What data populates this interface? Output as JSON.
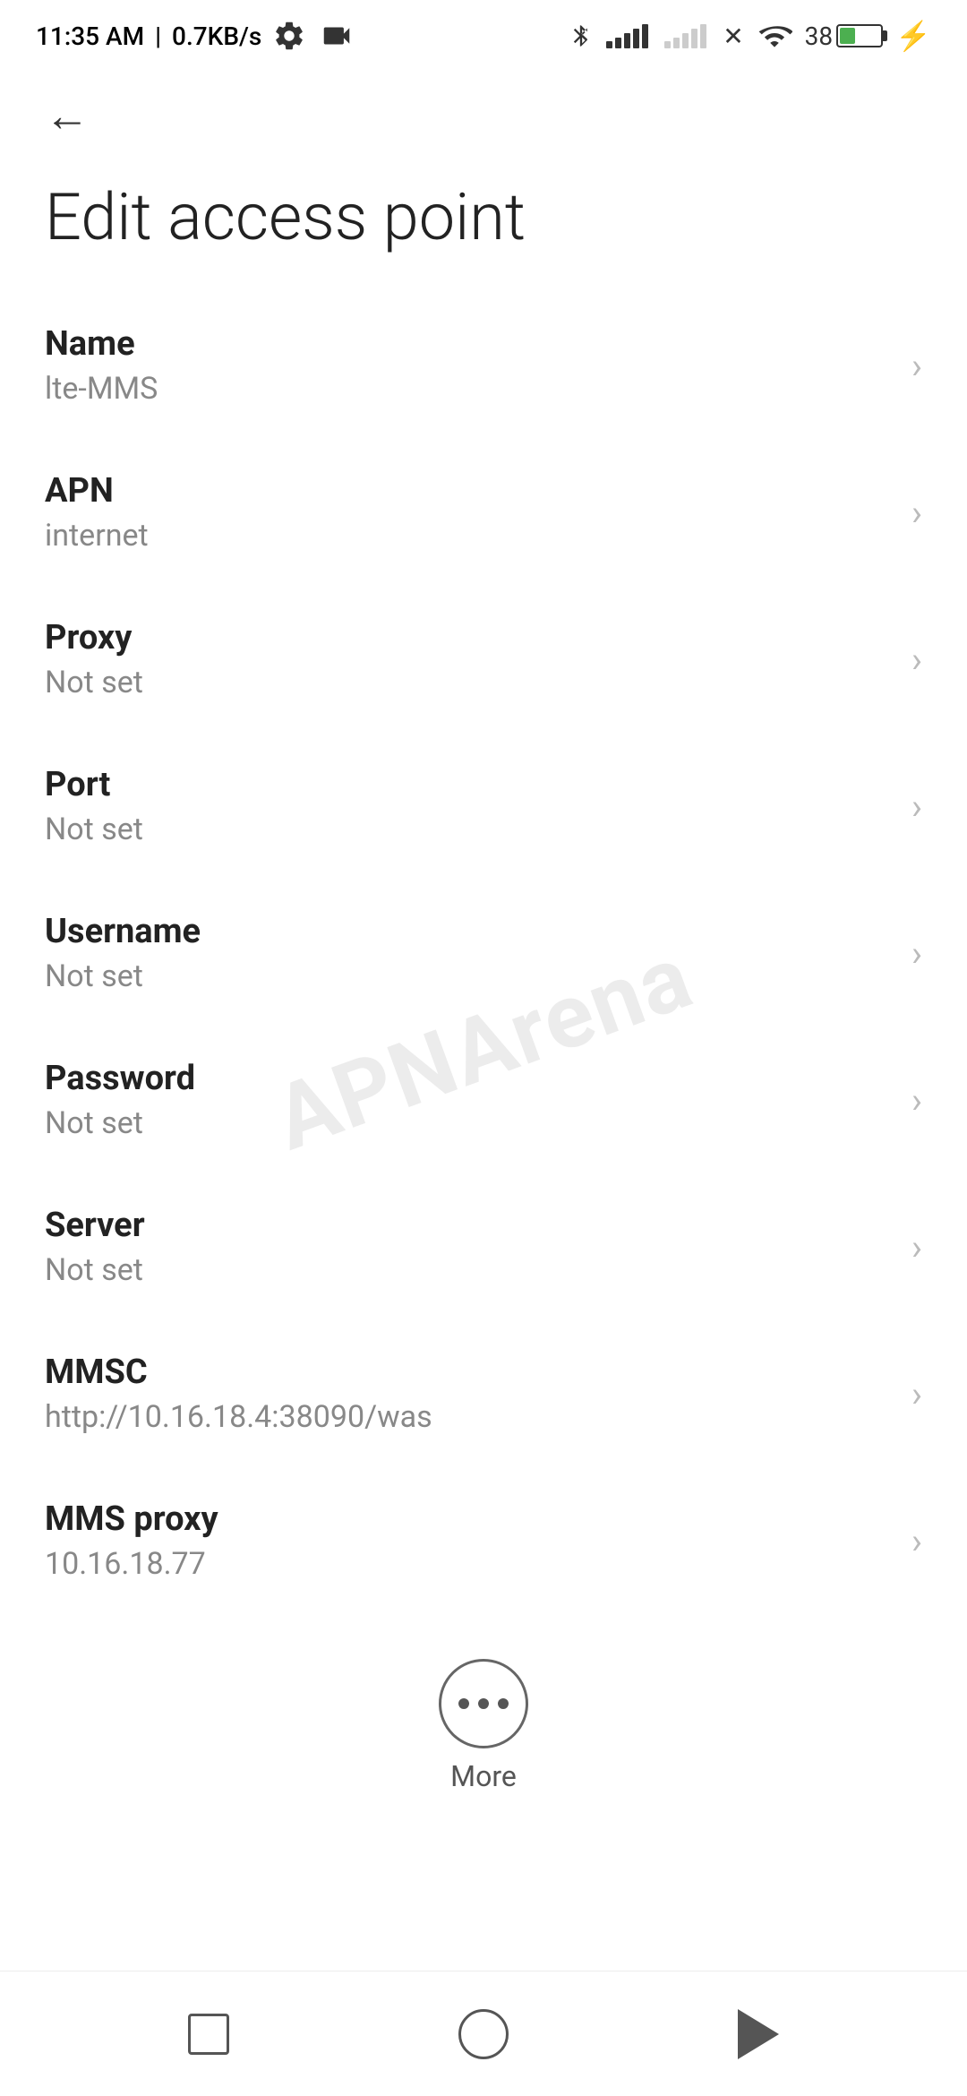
{
  "statusBar": {
    "time": "11:35 AM",
    "speed": "0.7KB/s"
  },
  "header": {
    "backLabel": "←"
  },
  "page": {
    "title": "Edit access point"
  },
  "settings": {
    "items": [
      {
        "label": "Name",
        "value": "lte-MMS"
      },
      {
        "label": "APN",
        "value": "internet"
      },
      {
        "label": "Proxy",
        "value": "Not set"
      },
      {
        "label": "Port",
        "value": "Not set"
      },
      {
        "label": "Username",
        "value": "Not set"
      },
      {
        "label": "Password",
        "value": "Not set"
      },
      {
        "label": "Server",
        "value": "Not set"
      },
      {
        "label": "MMSC",
        "value": "http://10.16.18.4:38090/was"
      },
      {
        "label": "MMS proxy",
        "value": "10.16.18.77"
      }
    ]
  },
  "more": {
    "label": "More"
  },
  "navBar": {
    "square": "■",
    "circle": "○",
    "triangle": "◁"
  },
  "watermark": "APNArena"
}
